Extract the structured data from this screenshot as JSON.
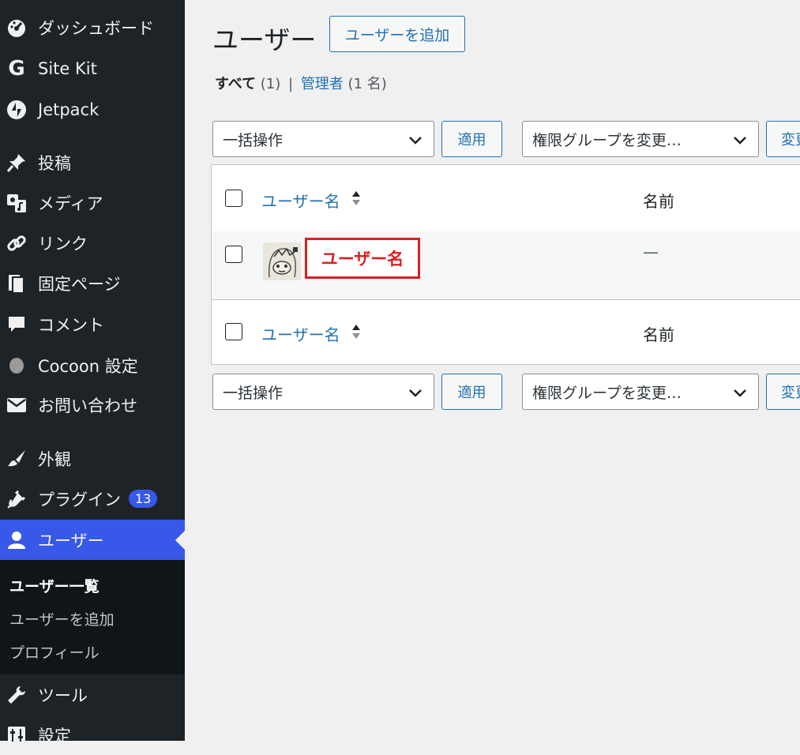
{
  "sidebar": {
    "items": [
      {
        "label": "ダッシュボード",
        "icon": "dashboard-icon"
      },
      {
        "label": "Site Kit",
        "icon": "google-g-icon"
      },
      {
        "label": "Jetpack",
        "icon": "jetpack-icon"
      },
      {
        "label": "投稿",
        "icon": "pushpin-icon"
      },
      {
        "label": "メディア",
        "icon": "media-icon"
      },
      {
        "label": "リンク",
        "icon": "link-icon"
      },
      {
        "label": "固定ページ",
        "icon": "page-icon"
      },
      {
        "label": "コメント",
        "icon": "comment-icon"
      },
      {
        "label": "Cocoon 設定",
        "icon": "cocoon-icon"
      },
      {
        "label": "お問い合わせ",
        "icon": "mail-icon"
      },
      {
        "label": "外観",
        "icon": "paintbrush-icon"
      },
      {
        "label": "プラグイン",
        "icon": "plugin-icon",
        "badge": "13"
      },
      {
        "label": "ユーザー",
        "icon": "user-icon"
      },
      {
        "label": "ツール",
        "icon": "wrench-icon"
      },
      {
        "label": "設定",
        "icon": "settings-icon"
      }
    ],
    "submenu": [
      "ユーザー一覧",
      "ユーザーを追加",
      "プロフィール"
    ]
  },
  "header": {
    "title": "ユーザー",
    "add_button": "ユーザーを追加"
  },
  "filters": {
    "all": "すべて",
    "all_count": "(1)",
    "separator": "|",
    "admin": "管理者",
    "admin_count": "(1 名)"
  },
  "bulk": {
    "action": "一括操作",
    "apply": "適用",
    "role": "権限グループを変更…",
    "change": "変更"
  },
  "table": {
    "col_username": "ユーザー名",
    "col_name": "名前",
    "row": {
      "username": "ユーザー名",
      "name": "—"
    }
  },
  "colors": {
    "accent": "#3858e9",
    "link": "#2271b1",
    "highlight": "#d92020"
  }
}
